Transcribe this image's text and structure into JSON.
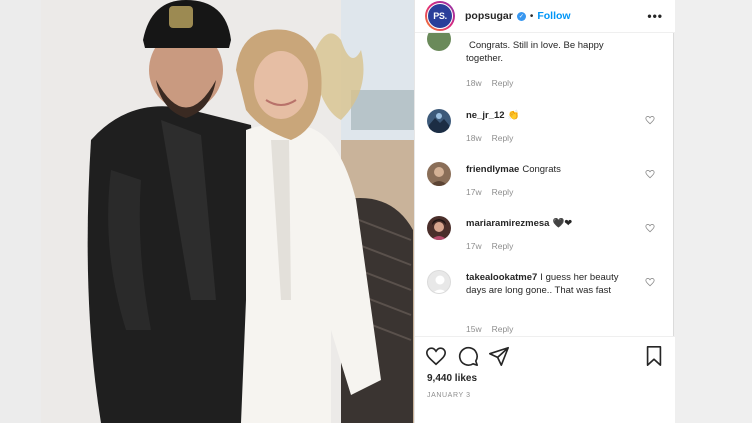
{
  "post": {
    "username": "popsugar",
    "avatar_text": "PS.",
    "follow_label": "Follow",
    "more_label": "•••",
    "separator": "•"
  },
  "comments": [
    {
      "user": "",
      "text": "Congrats. Still in love. Be happy together.",
      "time": "18w",
      "reply": "Reply"
    },
    {
      "user": "ne_jr_12",
      "text": "👏",
      "time": "18w",
      "reply": "Reply"
    },
    {
      "user": "friendlymae",
      "text": "Congrats",
      "time": "17w",
      "reply": "Reply"
    },
    {
      "user": "mariaramirezmesa",
      "text": "🖤❤",
      "time": "17w",
      "reply": "Reply"
    },
    {
      "user": "takealookatme7",
      "text": "I guess her beauty days are long gone.. That was fast",
      "time": "15w",
      "reply": "Reply"
    }
  ],
  "actions": {
    "likes": "9,440 likes",
    "date": "JANUARY 3"
  },
  "colors": {
    "link": "#0095f6",
    "muted": "#8e8e8e",
    "text": "#262626"
  },
  "icons": [
    "verified-badge-icon",
    "heart-icon",
    "comment-icon",
    "share-icon",
    "bookmark-icon",
    "more-icon"
  ]
}
